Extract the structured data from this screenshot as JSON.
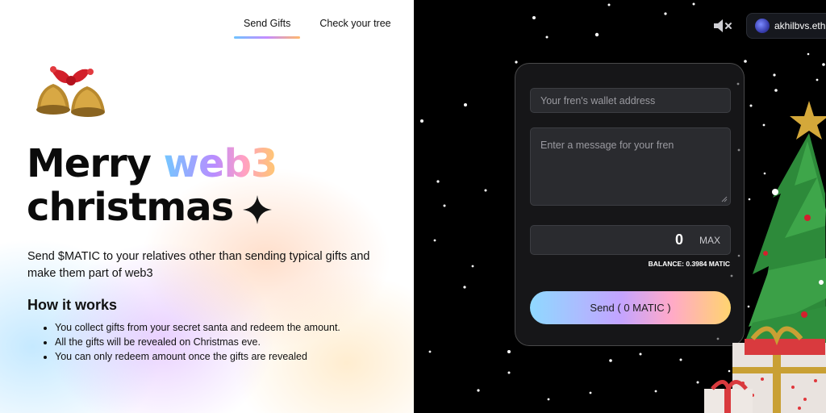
{
  "nav": {
    "tabs": [
      {
        "label": "Send Gifts"
      },
      {
        "label": "Check your tree"
      }
    ]
  },
  "hero": {
    "title_line1_prefix": "Merry",
    "title_highlight": "web3",
    "title_line2": "christmas",
    "subtitle": "Send $MATIC to your relatives other than sending typical gifts and make them part of web3"
  },
  "how_it_works": {
    "title": "How it works",
    "items": [
      "You collect gifts from your secret santa and redeem the amount.",
      "All the gifts will be revealed on Christmas eve.",
      "You can only redeem amount once the gifts are revealed"
    ]
  },
  "wallet": {
    "address": "akhilbvs.eth"
  },
  "form": {
    "address_placeholder": "Your fren's wallet address",
    "message_placeholder": "Enter a message for your fren",
    "amount": "0",
    "max_label": "MAX",
    "balance": "BALANCE: 0.3984 MATIC",
    "send_label": "Send ( 0 MATIC )"
  },
  "colors": {
    "accent_blue": "#74c7ff",
    "accent_purple": "#b98cff",
    "accent_pink": "#ff9fc6",
    "accent_orange": "#ffc86e"
  },
  "icons": {
    "mute": "speaker-muted-icon",
    "sparkle": "sparkle-icon",
    "bells": "christmas-bells-icon",
    "tree": "christmas-tree-icon"
  }
}
